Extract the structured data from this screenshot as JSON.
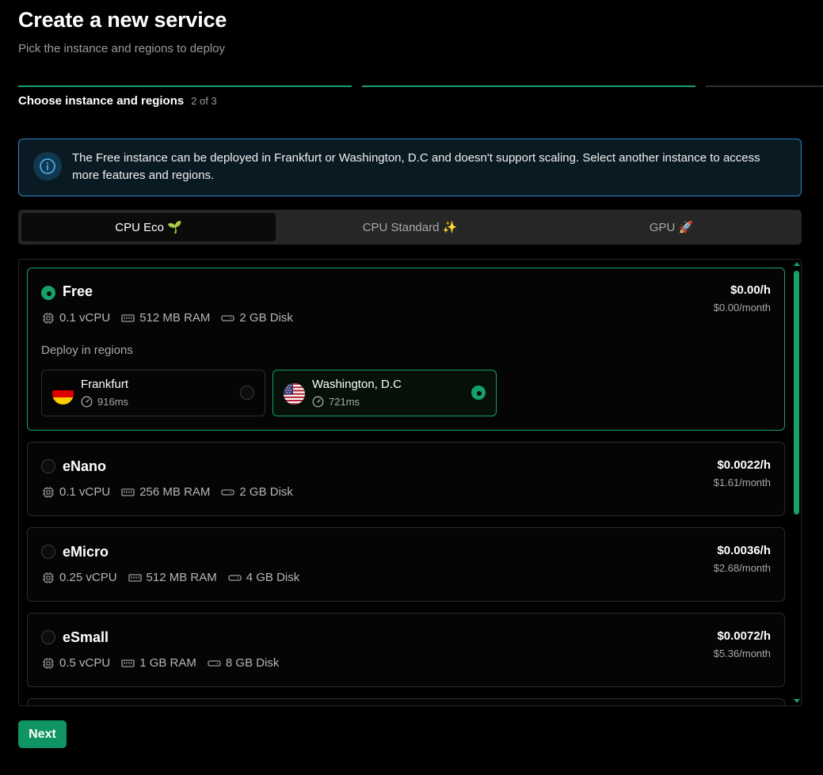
{
  "header": {
    "title": "Create a new service",
    "subtitle": "Pick the instance and regions to deploy"
  },
  "stepper": {
    "label": "Choose instance and regions",
    "count": "2 of 3",
    "current": 2,
    "total": 3
  },
  "info": {
    "icon": "info-icon",
    "text": "The Free instance can be deployed in Frankfurt or Washington, D.C and doesn't support scaling. Select another instance to access more features and regions."
  },
  "tabs": [
    {
      "label": "CPU Eco 🌱",
      "active": true
    },
    {
      "label": "CPU Standard ✨",
      "active": false
    },
    {
      "label": "GPU 🚀",
      "active": false
    }
  ],
  "instances": [
    {
      "name": "Free",
      "selected": true,
      "vcpu": "0.1 vCPU",
      "ram": "512 MB RAM",
      "disk": "2 GB Disk",
      "price_hour": "$0.00/h",
      "price_month": "$0.00/month",
      "regions_label": "Deploy in regions",
      "regions": [
        {
          "name": "Frankfurt",
          "latency": "916ms",
          "flag": "germany-flag",
          "selected": false
        },
        {
          "name": "Washington, D.C",
          "latency": "721ms",
          "flag": "usa-flag",
          "selected": true
        }
      ]
    },
    {
      "name": "eNano",
      "selected": false,
      "vcpu": "0.1 vCPU",
      "ram": "256 MB RAM",
      "disk": "2 GB Disk",
      "price_hour": "$0.0022/h",
      "price_month": "$1.61/month"
    },
    {
      "name": "eMicro",
      "selected": false,
      "vcpu": "0.25 vCPU",
      "ram": "512 MB RAM",
      "disk": "4 GB Disk",
      "price_hour": "$0.0036/h",
      "price_month": "$2.68/month"
    },
    {
      "name": "eSmall",
      "selected": false,
      "vcpu": "0.5 vCPU",
      "ram": "1 GB RAM",
      "disk": "8 GB Disk",
      "price_hour": "$0.0072/h",
      "price_month": "$5.36/month"
    }
  ],
  "actions": {
    "next_label": "Next"
  },
  "colors": {
    "accent": "#16a06a",
    "info_border": "#2f86c0",
    "background": "#000000"
  }
}
